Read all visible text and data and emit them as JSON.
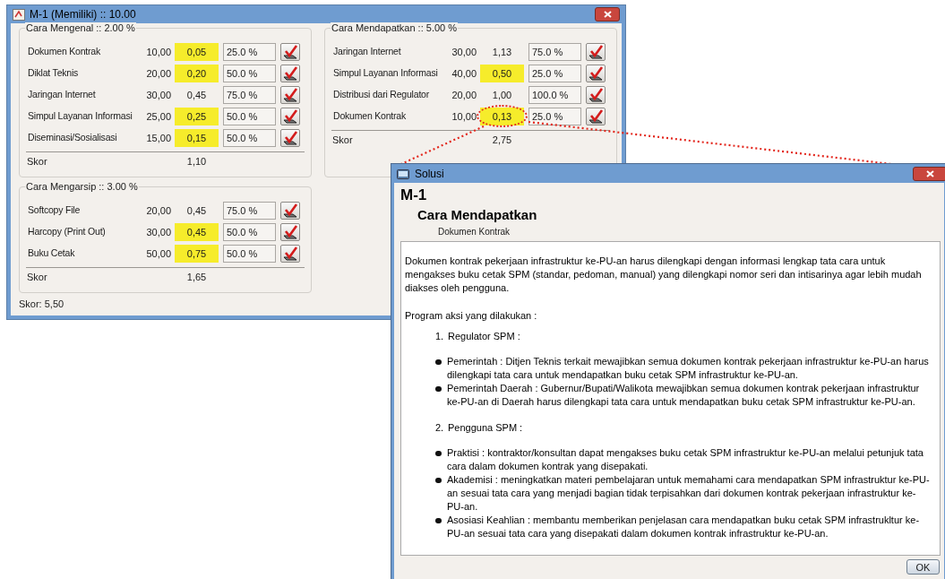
{
  "main_window": {
    "title": "M-1 (Memiliki) :: 10.00",
    "groups": [
      {
        "title": "Cara Mengenal :: 2.00 %",
        "score_label": "Skor",
        "score": "1,10",
        "rows": [
          {
            "label": "Dokumen Kontrak",
            "weight": "10,00",
            "value": "0,05",
            "highlighted": true,
            "circled": false,
            "percent": "25.0 %"
          },
          {
            "label": "Diklat Teknis",
            "weight": "20,00",
            "value": "0,20",
            "highlighted": true,
            "circled": false,
            "percent": "50.0 %"
          },
          {
            "label": "Jaringan Internet",
            "weight": "30,00",
            "value": "0,45",
            "highlighted": false,
            "circled": false,
            "percent": "75.0 %"
          },
          {
            "label": "Simpul Layanan Informasi",
            "weight": "25,00",
            "value": "0,25",
            "highlighted": true,
            "circled": false,
            "percent": "50.0 %"
          },
          {
            "label": "Diseminasi/Sosialisasi",
            "weight": "15,00",
            "value": "0,15",
            "highlighted": true,
            "circled": false,
            "percent": "50.0 %"
          }
        ]
      },
      {
        "title": "Cara Mendapatkan :: 5.00 %",
        "score_label": "Skor",
        "score": "2,75",
        "rows": [
          {
            "label": "Jaringan Internet",
            "weight": "30,00",
            "value": "1,13",
            "highlighted": false,
            "circled": false,
            "percent": "75.0 %"
          },
          {
            "label": "Simpul Layanan Informasi",
            "weight": "40,00",
            "value": "0,50",
            "highlighted": true,
            "circled": false,
            "percent": "25.0 %"
          },
          {
            "label": "Distribusi dari Regulator",
            "weight": "20,00",
            "value": "1,00",
            "highlighted": false,
            "circled": false,
            "percent": "100.0 %"
          },
          {
            "label": "Dokumen Kontrak",
            "weight": "10,00",
            "value": "0,13",
            "highlighted": true,
            "circled": true,
            "percent": "25.0 %"
          }
        ]
      },
      {
        "title": "Cara Mengarsip :: 3.00 %",
        "score_label": "Skor",
        "score": "1,65",
        "rows": [
          {
            "label": "Softcopy File",
            "weight": "20,00",
            "value": "0,45",
            "highlighted": false,
            "circled": false,
            "percent": "75.0 %"
          },
          {
            "label": "Harcopy (Print Out)",
            "weight": "30,00",
            "value": "0,45",
            "highlighted": true,
            "circled": false,
            "percent": "50.0 %"
          },
          {
            "label": "Buku Cetak",
            "weight": "50,00",
            "value": "0,75",
            "highlighted": true,
            "circled": false,
            "percent": "50.0 %"
          }
        ]
      }
    ],
    "total": "Skor: 5,50"
  },
  "solusi_window": {
    "title": "Solusi",
    "code": "M-1",
    "heading": "Cara Mendapatkan",
    "subheading": "Dokumen Kontrak",
    "intro": "Dokumen kontrak pekerjaan infrastruktur ke-PU-an harus dilengkapi dengan informasi lengkap tata cara untuk mengakses buku cetak SPM (standar, pedoman, manual) yang dilengkapi nomor seri dan intisarinya agar lebih mudah diakses oleh pengguna.",
    "program_label": "Program aksi yang dilakukan :",
    "sections": [
      {
        "number": "1.",
        "title": "Regulator SPM :",
        "bullets": [
          "Pemerintah : Ditjen Teknis terkait mewajibkan semua dokumen kontrak pekerjaan infrastruktur ke-PU-an harus dilengkapi tata cara untuk mendapatkan buku cetak SPM infrastruktur ke-PU-an.",
          "Pemerintah Daerah : Gubernur/Bupati/Walikota mewajibkan semua dokumen kontrak pekerjaan infrastruktur ke-PU-an di Daerah harus dilengkapi tata cara untuk mendapatkan buku cetak SPM infrastruktur ke-PU-an."
        ]
      },
      {
        "number": "2.",
        "title": "Pengguna SPM :",
        "bullets": [
          "Praktisi : kontraktor/konsultan dapat mengakses buku cetak SPM infrastruktur ke-PU-an melalui petunjuk tata cara dalam dokumen kontrak yang disepakati.",
          "Akademisi : meningkatkan materi pembelajaran untuk memahami cara mendapatkan SPM infrastruktur ke-PU-an sesuai tata cara yang menjadi bagian tidak terpisahkan dari dokumen kontrak pekerjaan infrastruktur ke-PU-an.",
          "Asosiasi Keahlian : membantu memberikan penjelasan cara mendapatkan buku cetak SPM infrastrukltur ke-PU-an sesuai tata cara yang disepakati dalam dokumen kontrak infrastruktur ke-PU-an."
        ]
      }
    ],
    "button": "OK"
  }
}
